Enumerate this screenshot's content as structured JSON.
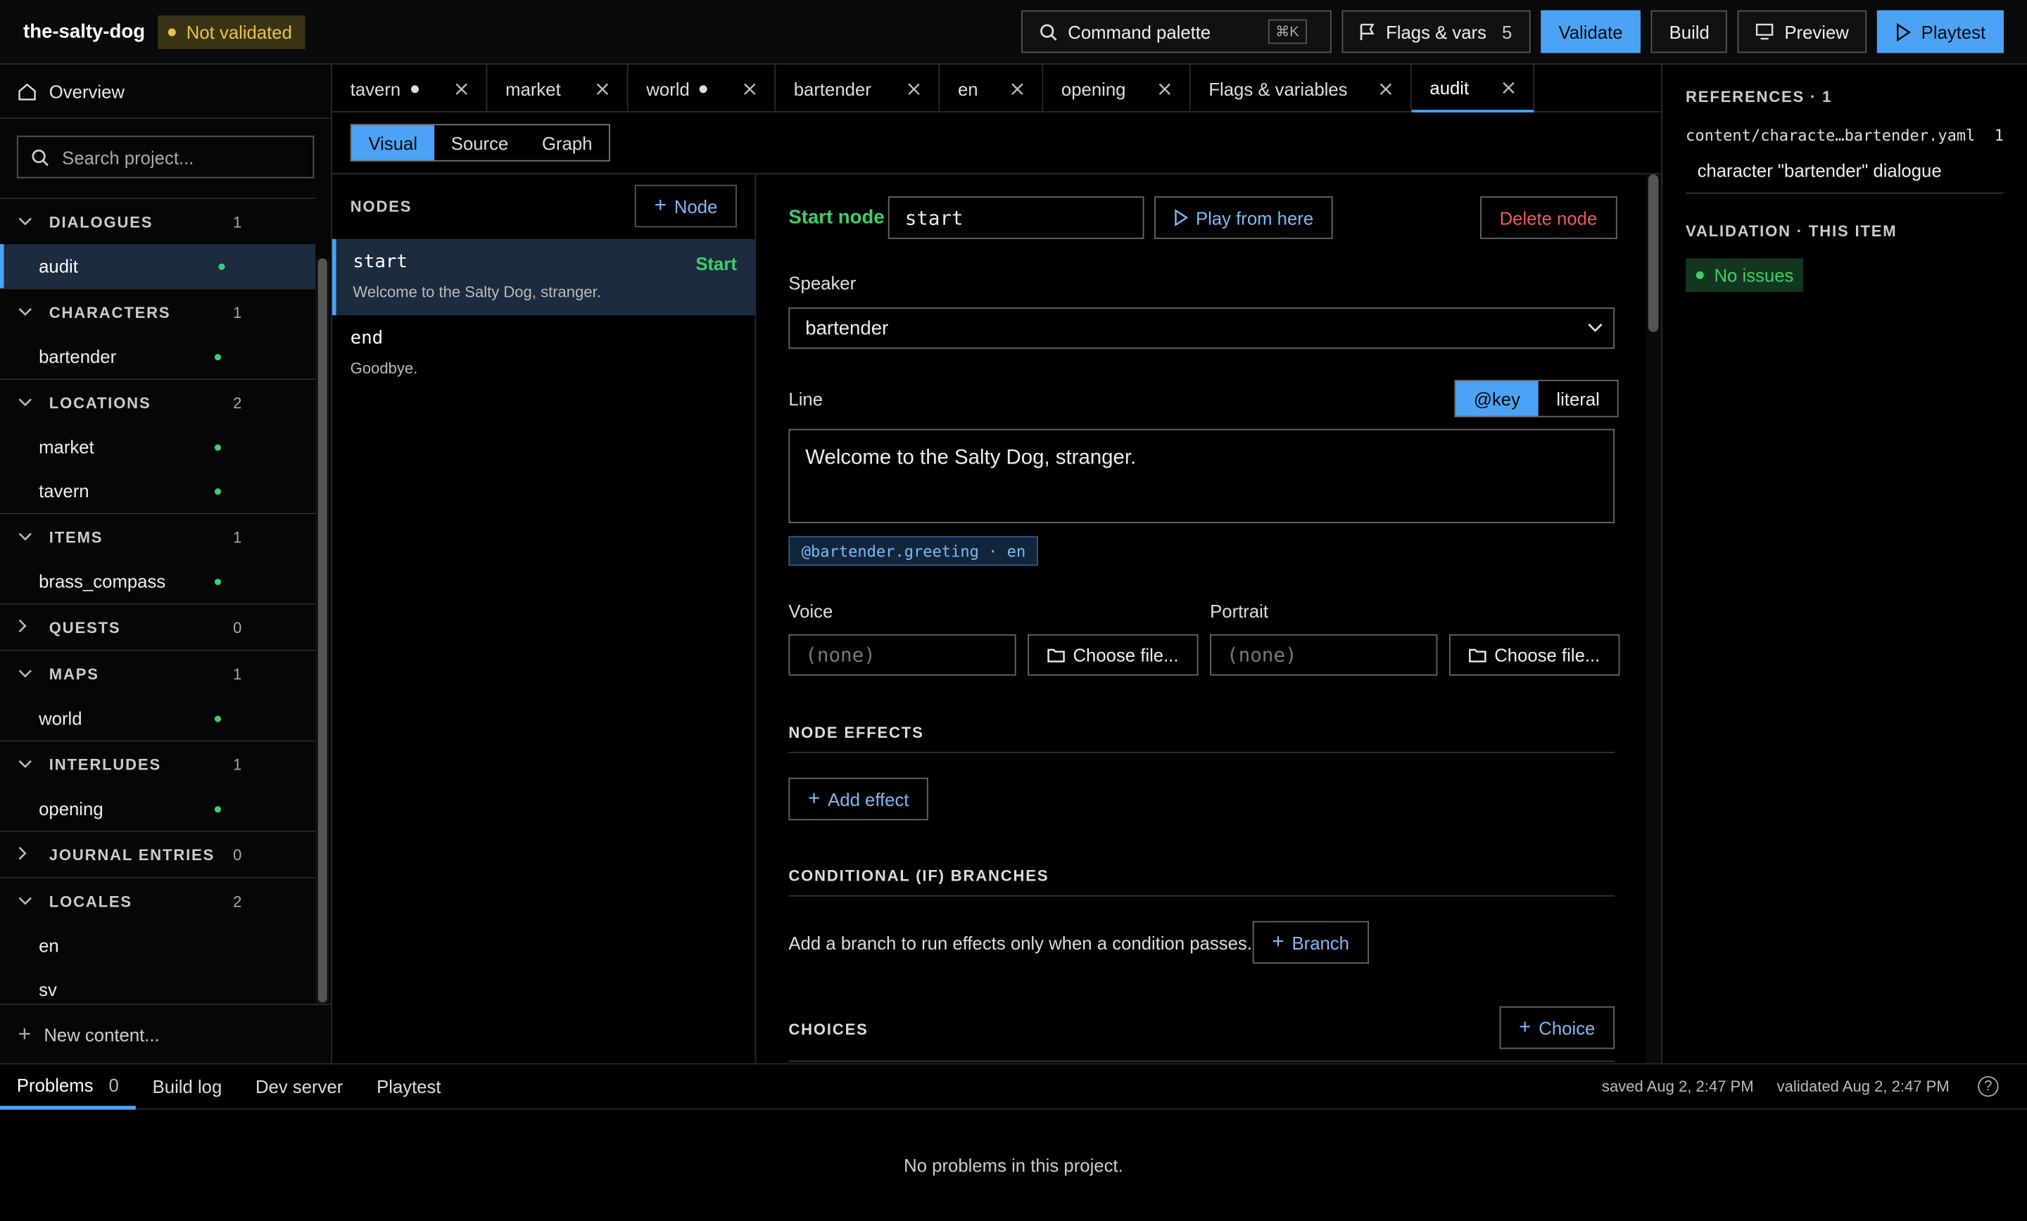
{
  "topbar": {
    "project": "the-salty-dog",
    "status": "Not validated",
    "command_palette": "Command palette",
    "shortcut": "⌘K",
    "flags_label": "Flags & vars",
    "flags_count": "5",
    "validate": "Validate",
    "build": "Build",
    "preview": "Preview",
    "playtest": "Playtest"
  },
  "sidebar": {
    "overview": "Overview",
    "search_placeholder": "Search project...",
    "sections": [
      {
        "label": "DIALOGUES",
        "count": "1",
        "items": [
          "audit"
        ]
      },
      {
        "label": "CHARACTERS",
        "count": "1",
        "items": [
          "bartender"
        ]
      },
      {
        "label": "LOCATIONS",
        "count": "2",
        "items": [
          "market",
          "tavern"
        ]
      },
      {
        "label": "ITEMS",
        "count": "1",
        "items": [
          "brass_compass"
        ]
      },
      {
        "label": "QUESTS",
        "count": "0",
        "items": []
      },
      {
        "label": "MAPS",
        "count": "1",
        "items": [
          "world"
        ]
      },
      {
        "label": "INTERLUDES",
        "count": "1",
        "items": [
          "opening"
        ]
      },
      {
        "label": "JOURNAL ENTRIES",
        "count": "0",
        "items": []
      },
      {
        "label": "LOCALES",
        "count": "2",
        "items": [
          "en",
          "sv"
        ]
      }
    ],
    "new_content": "New content..."
  },
  "tabs": [
    "tavern",
    "market",
    "world",
    "bartender",
    "en",
    "opening",
    "Flags & variables",
    "audit"
  ],
  "view_modes": [
    "Visual",
    "Source",
    "Graph"
  ],
  "nodes": {
    "title": "NODES",
    "add": "Node",
    "list": [
      {
        "id": "start",
        "text": "Welcome to the Salty Dog, stranger.",
        "tag": "Start"
      },
      {
        "id": "end",
        "text": "Goodbye."
      }
    ]
  },
  "form": {
    "start_node_label": "Start node",
    "start_node_value": "start",
    "play": "Play from here",
    "delete": "Delete node",
    "speaker_label": "Speaker",
    "speaker_value": "bartender",
    "line_label": "Line",
    "key_mode": "@key",
    "literal_mode": "literal",
    "line_text": "Welcome to the Salty Dog, stranger.",
    "line_key": "@bartender.greeting · en",
    "voice_label": "Voice",
    "voice_value": "(none)",
    "portrait_label": "Portrait",
    "portrait_value": "(none)",
    "choose_file": "Choose file...",
    "effects_head": "NODE EFFECTS",
    "add_effect": "Add effect",
    "cond_head": "CONDITIONAL (IF) BRANCHES",
    "cond_hint": "Add a branch to run effects only when a condition passes.",
    "branch": "Branch",
    "choices_head": "CHOICES",
    "choice": "Choice"
  },
  "right": {
    "references_head": "REFERENCES · 1",
    "ref_path": "content/characte…bartender.yaml",
    "ref_count": "1",
    "ref_desc": "character \"bartender\" dialogue",
    "validation_head": "VALIDATION · THIS ITEM",
    "no_issues": "No issues"
  },
  "bottom": {
    "problems": "Problems",
    "problems_count": "0",
    "build_log": "Build log",
    "dev_server": "Dev server",
    "playtest": "Playtest",
    "saved": "saved Aug 2, 2:47 PM",
    "validated": "validated Aug 2, 2:47 PM",
    "help": "?",
    "empty": "No problems in this project."
  },
  "colors": {
    "accent": "#4ca3f5",
    "ok": "#3ecf6a",
    "warn": "#e8c34a",
    "danger": "#f0595e"
  }
}
